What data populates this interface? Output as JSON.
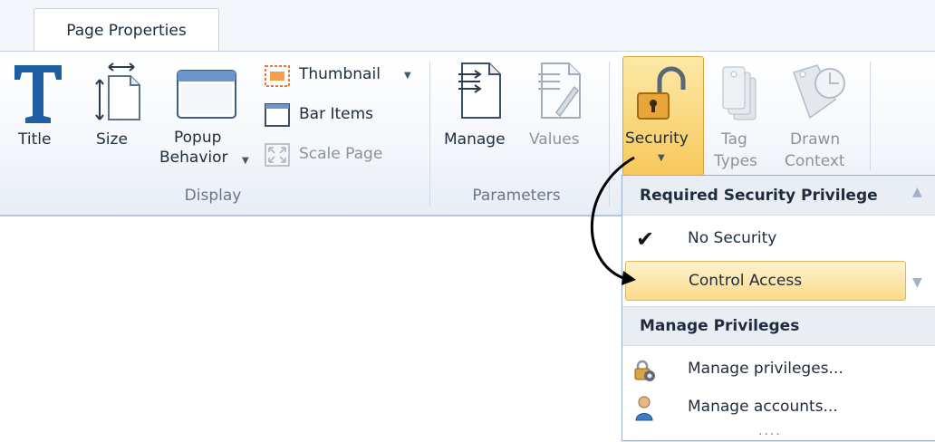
{
  "tabs": {
    "active": "Page Properties"
  },
  "display": {
    "title_label": "Title",
    "size_label": "Size",
    "popup_line1": "Popup",
    "popup_line2": "Behavior",
    "thumbnail_label": "Thumbnail",
    "bar_items_label": "Bar Items",
    "scale_page_label": "Scale Page",
    "group_label": "Display"
  },
  "parameters": {
    "manage_label": "Manage",
    "values_label": "Values",
    "group_label": "Parameters"
  },
  "security": {
    "security_label": "Security",
    "tag_types_line1": "Tag",
    "tag_types_line2": "Types",
    "drawn_context_line1": "Drawn",
    "drawn_context_line2": "Context"
  },
  "dropdown": {
    "section1_header": "Required Security Privilege",
    "no_security": "No Security",
    "control_access": "Control Access",
    "section2_header": "Manage Privileges",
    "manage_privileges": "Manage privileges...",
    "manage_accounts": "Manage accounts..."
  },
  "colors": {
    "accent_highlight": "#f7c85c",
    "title_icon_blue": "#1e5fa3",
    "arrow": "#000000"
  }
}
